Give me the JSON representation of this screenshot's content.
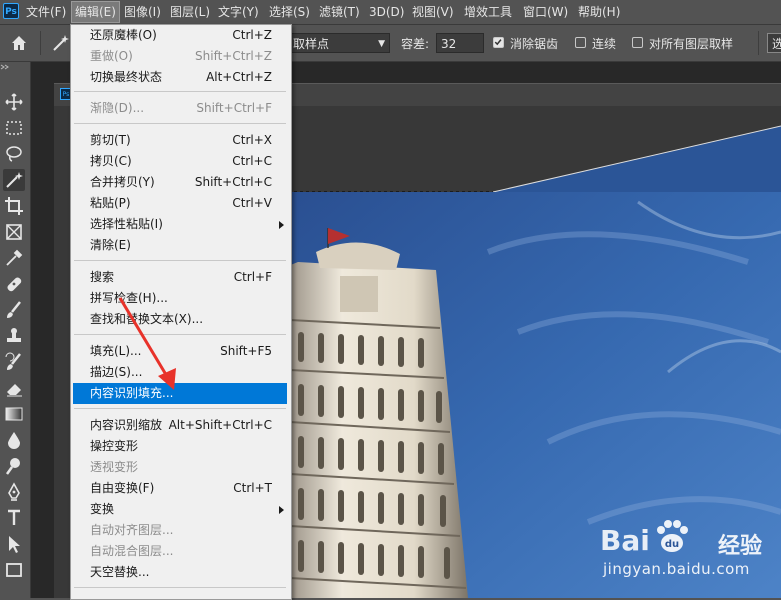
{
  "app": {
    "logo": "Ps"
  },
  "menubar": {
    "items": [
      "文件(F)",
      "编辑(E)",
      "图像(I)",
      "图层(L)",
      "文字(Y)",
      "选择(S)",
      "滤镜(T)",
      "3D(D)",
      "视图(V)",
      "增效工具",
      "窗口(W)",
      "帮助(H)"
    ],
    "active": "编辑(E)"
  },
  "options": {
    "sample_size": "取样点",
    "tolerance_label": "容差:",
    "tolerance_value": "32",
    "antialias_label": "消除锯齿",
    "antialias_checked": true,
    "contiguous_label": "连续",
    "contiguous_checked": false,
    "all_layers_label": "对所有图层取样",
    "all_layers_checked": false,
    "truncated_button": "选"
  },
  "edit_menu": {
    "items": [
      {
        "label": "还原魔棒(O)",
        "shortcut": "Ctrl+Z",
        "state": "normal"
      },
      {
        "label": "重做(O)",
        "shortcut": "Shift+Ctrl+Z",
        "state": "disabled"
      },
      {
        "label": "切换最终状态",
        "shortcut": "Alt+Ctrl+Z",
        "state": "normal"
      },
      {
        "label": "渐隐(D)...",
        "shortcut": "Shift+Ctrl+F",
        "state": "disabled"
      },
      {
        "label": "剪切(T)",
        "shortcut": "Ctrl+X",
        "state": "normal"
      },
      {
        "label": "拷贝(C)",
        "shortcut": "Ctrl+C",
        "state": "normal"
      },
      {
        "label": "合并拷贝(Y)",
        "shortcut": "Shift+Ctrl+C",
        "state": "normal"
      },
      {
        "label": "粘贴(P)",
        "shortcut": "Ctrl+V",
        "state": "normal"
      },
      {
        "label": "选择性粘贴(I)",
        "shortcut": "",
        "state": "submenu"
      },
      {
        "label": "清除(E)",
        "shortcut": "",
        "state": "normal"
      },
      {
        "label": "搜索",
        "shortcut": "Ctrl+F",
        "state": "normal"
      },
      {
        "label": "拼写检查(H)...",
        "shortcut": "",
        "state": "normal"
      },
      {
        "label": "查找和替换文本(X)...",
        "shortcut": "",
        "state": "normal"
      },
      {
        "label": "填充(L)...",
        "shortcut": "Shift+F5",
        "state": "normal"
      },
      {
        "label": "描边(S)...",
        "shortcut": "",
        "state": "normal"
      },
      {
        "label": "内容识别填充...",
        "shortcut": "",
        "state": "highlighted"
      },
      {
        "label": "内容识别缩放",
        "shortcut": "Alt+Shift+Ctrl+C",
        "state": "normal"
      },
      {
        "label": "操控变形",
        "shortcut": "",
        "state": "normal"
      },
      {
        "label": "透视变形",
        "shortcut": "",
        "state": "disabled"
      },
      {
        "label": "自由变换(F)",
        "shortcut": "Ctrl+T",
        "state": "normal"
      },
      {
        "label": "变换",
        "shortcut": "",
        "state": "submenu"
      },
      {
        "label": "自动对齐图层...",
        "shortcut": "",
        "state": "disabled"
      },
      {
        "label": "自动混合图层...",
        "shortcut": "",
        "state": "disabled"
      },
      {
        "label": "天空替换...",
        "shortcut": "",
        "state": "normal"
      }
    ]
  },
  "watermark": {
    "brand": "Bai",
    "brand_cn": "经验",
    "url": "jingyan.baidu.com"
  },
  "colors": {
    "highlight": "#0078d7",
    "arrow": "#e8322a",
    "sky": "#2f5fa3"
  }
}
